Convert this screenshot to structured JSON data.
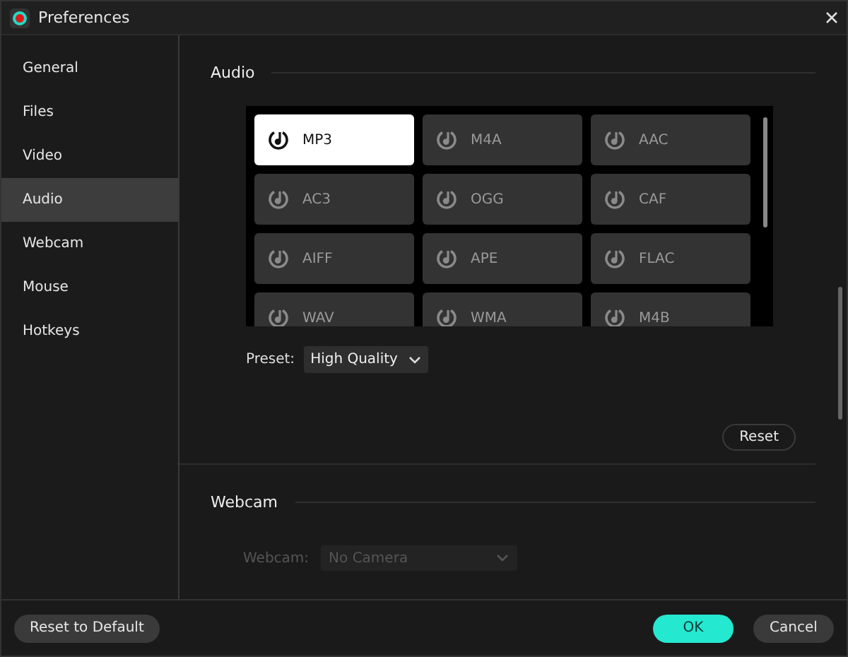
{
  "window": {
    "title": "Preferences"
  },
  "sidebar": {
    "items": [
      {
        "label": "General",
        "selected": false
      },
      {
        "label": "Files",
        "selected": false
      },
      {
        "label": "Video",
        "selected": false
      },
      {
        "label": "Audio",
        "selected": true
      },
      {
        "label": "Webcam",
        "selected": false
      },
      {
        "label": "Mouse",
        "selected": false
      },
      {
        "label": "Hotkeys",
        "selected": false
      }
    ]
  },
  "audio": {
    "heading": "Audio",
    "formats": [
      {
        "label": "MP3",
        "selected": true
      },
      {
        "label": "M4A",
        "selected": false
      },
      {
        "label": "AAC",
        "selected": false
      },
      {
        "label": "AC3",
        "selected": false
      },
      {
        "label": "OGG",
        "selected": false
      },
      {
        "label": "CAF",
        "selected": false
      },
      {
        "label": "AIFF",
        "selected": false
      },
      {
        "label": "APE",
        "selected": false
      },
      {
        "label": "FLAC",
        "selected": false
      },
      {
        "label": "WAV",
        "selected": false
      },
      {
        "label": "WMA",
        "selected": false
      },
      {
        "label": "M4B",
        "selected": false
      }
    ],
    "preset": {
      "label": "Preset:",
      "value": "High Quality"
    },
    "reset": "Reset"
  },
  "webcam": {
    "heading": "Webcam",
    "label": "Webcam:",
    "value": "No Camera",
    "disabled": true
  },
  "footer": {
    "reset_default": "Reset to Default",
    "ok": "OK",
    "cancel": "Cancel"
  }
}
